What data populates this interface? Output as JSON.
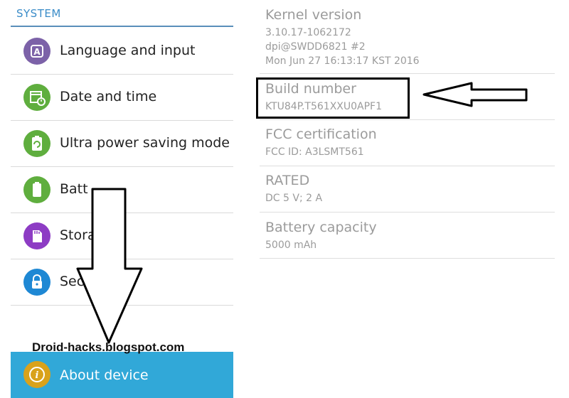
{
  "sidebar": {
    "section_title": "SYSTEM",
    "items": [
      {
        "label": "Language and input",
        "icon": "language-a-icon",
        "color": "#7c62a8"
      },
      {
        "label": "Date and time",
        "icon": "calendar-clock-icon",
        "color": "#5fae3e"
      },
      {
        "label": "Ultra power saving mode",
        "icon": "battery-recycle-icon",
        "color": "#5fae3e"
      },
      {
        "label": "Batt",
        "icon": "battery-icon",
        "color": "#5fae3e"
      },
      {
        "label": "Stora",
        "icon": "sd-card-icon",
        "color": "#8d3cc4"
      },
      {
        "label": "Sec",
        "icon": "lock-icon",
        "color": "#1e88d4"
      }
    ],
    "about": {
      "label": "About device",
      "icon": "info-icon",
      "color": "#d9a21b"
    },
    "accent_color": "#31a8d8"
  },
  "watermark": "Droid-hacks.blogspot.com",
  "details": [
    {
      "title": "Kernel version",
      "lines": [
        "3.10.17-1062172",
        "dpi@SWDD6821 #2",
        "Mon Jun 27 16:13:17 KST 2016"
      ]
    },
    {
      "title": "Build number",
      "lines": [
        "KTU84P.T561XXU0APF1"
      ]
    },
    {
      "title": "FCC certification",
      "lines": [
        "FCC ID: A3LSMT561"
      ]
    },
    {
      "title": "RATED",
      "lines": [
        "DC 5 V; 2 A"
      ]
    },
    {
      "title": "Battery capacity",
      "lines": [
        "5000 mAh"
      ]
    }
  ]
}
